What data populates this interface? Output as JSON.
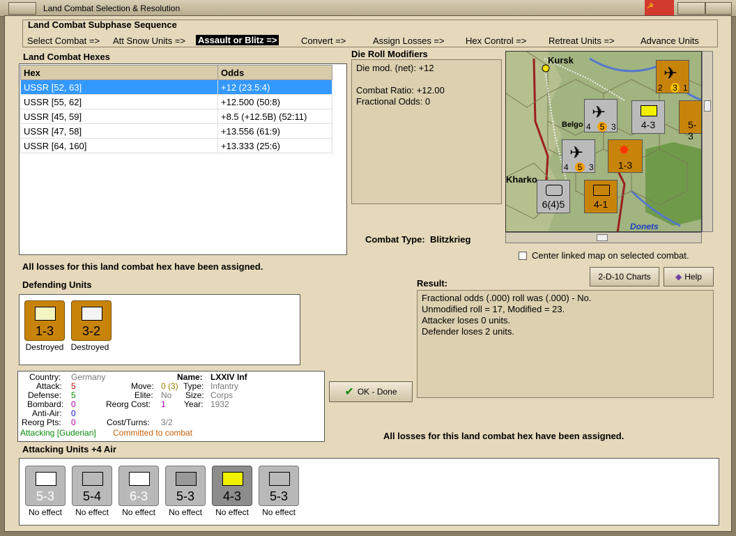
{
  "window": {
    "title": "Land Combat Selection & Resolution"
  },
  "subphase": {
    "title": "Land Combat Subphase Sequence",
    "steps": [
      "Select Combat =>",
      "Att Snow Units =>",
      "Assault or Blitz =>",
      "Convert =>",
      "Assign Losses =>",
      "Hex Control =>",
      "Retreat Units =>",
      "Advance Units"
    ],
    "active_index": 2
  },
  "hexes": {
    "title": "Land Combat Hexes",
    "col_hex": "Hex",
    "col_odds": "Odds",
    "rows": [
      {
        "hex": "USSR [52, 63]",
        "odds": "+12 (23.5:4)"
      },
      {
        "hex": "USSR [55, 62]",
        "odds": "+12.500 (50:8)"
      },
      {
        "hex": "USSR [45, 59]",
        "odds": "+8.5 (+12.5B) (52:11)"
      },
      {
        "hex": "USSR [47, 58]",
        "odds": "+13.556 (61:9)"
      },
      {
        "hex": "USSR [64, 160]",
        "odds": "+13.333 (25:6)"
      }
    ]
  },
  "die_roll": {
    "title": "Die Roll Modifiers",
    "lines": [
      "Die mod. (net): +12",
      "",
      "Combat Ratio: +12.00",
      "Fractional Odds: 0"
    ]
  },
  "combat_type": {
    "label": "Combat Type:",
    "value": "Blitzkrieg"
  },
  "center_map": {
    "label": "Center linked map on selected combat."
  },
  "buttons": {
    "charts": "2-D-10 Charts",
    "help": "Help",
    "ok": "OK - Done"
  },
  "losses_msg": "All losses for this land combat hex have been assigned.",
  "defending": {
    "title": "Defending Units",
    "units": [
      {
        "value": "1-3",
        "status": "Destroyed"
      },
      {
        "value": "3-2",
        "status": "Destroyed"
      }
    ]
  },
  "result": {
    "title": "Result:",
    "lines": [
      "Fractional odds (.000) roll was (.000)  - No.",
      "Unmodified roll = 17, Modified = 23.",
      "Attacker loses 0 units.",
      "Defender loses 2 units."
    ]
  },
  "unit_info": {
    "country_l": "Country:",
    "country_v": "Germany",
    "attack_l": "Attack:",
    "attack_v": "5",
    "defense_l": "Defense:",
    "defense_v": "5",
    "bombard_l": "Bombard:",
    "bombard_v": "0",
    "antiair_l": "Anti-Air:",
    "antiair_v": "0",
    "reorg_l": "Reorg Pts:",
    "reorg_v": "0",
    "name_l": "Name:",
    "name_v": "LXXIV Inf",
    "move_l": "Move:",
    "move_v": "0 (3)",
    "type_l": "Type:",
    "type_v": "Infantry",
    "elite_l": "Elite:",
    "elite_v": "No",
    "size_l": "Size:",
    "size_v": "Corps",
    "reorgcost_l": "Reorg Cost:",
    "reorgcost_v": "1",
    "year_l": "Year:",
    "year_v": "1932",
    "cost_l": "Cost/Turns:",
    "cost_v": "3/2",
    "attacking": "Attacking [Guderian]",
    "committed": "Committed to combat"
  },
  "attacking": {
    "title": "Attacking Units +4 Air",
    "units": [
      {
        "value": "5-3",
        "status": "No effect"
      },
      {
        "value": "5-4",
        "status": "No effect"
      },
      {
        "value": "6-3",
        "status": "No effect"
      },
      {
        "value": "5-3",
        "status": "No effect"
      },
      {
        "value": "4-3",
        "status": "No effect"
      },
      {
        "value": "5-3",
        "status": "No effect"
      }
    ]
  },
  "map": {
    "labels": [
      "Kursk",
      "Belgo",
      "Kharko",
      "Donets"
    ],
    "counters": [
      "4-3",
      "1-3",
      "6(4)5",
      "4-1",
      "5-3",
      "4",
      "5",
      "3",
      "2",
      "3",
      "1"
    ]
  },
  "colors": {
    "orange": "#c8840a",
    "gray": "#b9b9b9",
    "selected": "#3399ff",
    "red_text": "#d01010",
    "green_text": "#0a8a0a",
    "magenta": "#b000b0",
    "blue": "#1010c0"
  }
}
